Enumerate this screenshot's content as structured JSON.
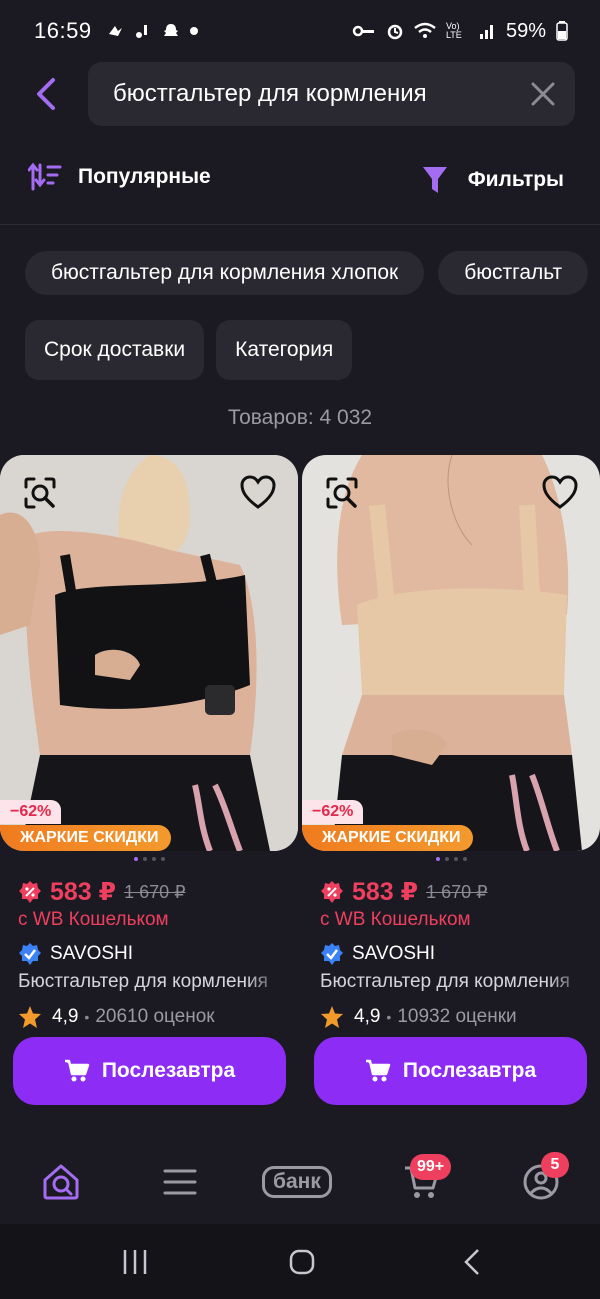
{
  "status": {
    "time": "16:59",
    "battery": "59%",
    "net": "Vo) LTE"
  },
  "search": {
    "query": "бюстгальтер для кормления"
  },
  "sort": {
    "label": "Популярные"
  },
  "filters": {
    "label": "Фильтры"
  },
  "suggestions": [
    "бюстгальтер для кормления хлопок",
    "бюстгальт"
  ],
  "filter_chips": [
    "Срок доставки",
    "Категория"
  ],
  "count_text": "Товаров: 4 032",
  "products": [
    {
      "discount": "−62%",
      "hot": "ЖАРКИЕ СКИДКИ",
      "price": "583 ₽",
      "old_price": "1 670 ₽",
      "wallet": "с WB Кошельком",
      "brand": "SAVOSHI",
      "title": "Бюстгальтер для кормления",
      "rating": "4,9",
      "reviews": "20610 оценок",
      "button": "Послезавтра"
    },
    {
      "discount": "−62%",
      "hot": "ЖАРКИЕ СКИДКИ",
      "price": "583 ₽",
      "old_price": "1 670 ₽",
      "wallet": "с WB Кошельком",
      "brand": "SAVOSHI",
      "title": "Бюстгальтер для кормления",
      "rating": "4,9",
      "reviews": "10932 оценки",
      "button": "Послезавтра"
    }
  ],
  "nav": {
    "bank_label": "банк",
    "cart_badge": "99+",
    "profile_badge": "5"
  },
  "colors": {
    "accent": "#8c2cf5",
    "price": "#ee3f5e",
    "background": "#1b1a22"
  }
}
